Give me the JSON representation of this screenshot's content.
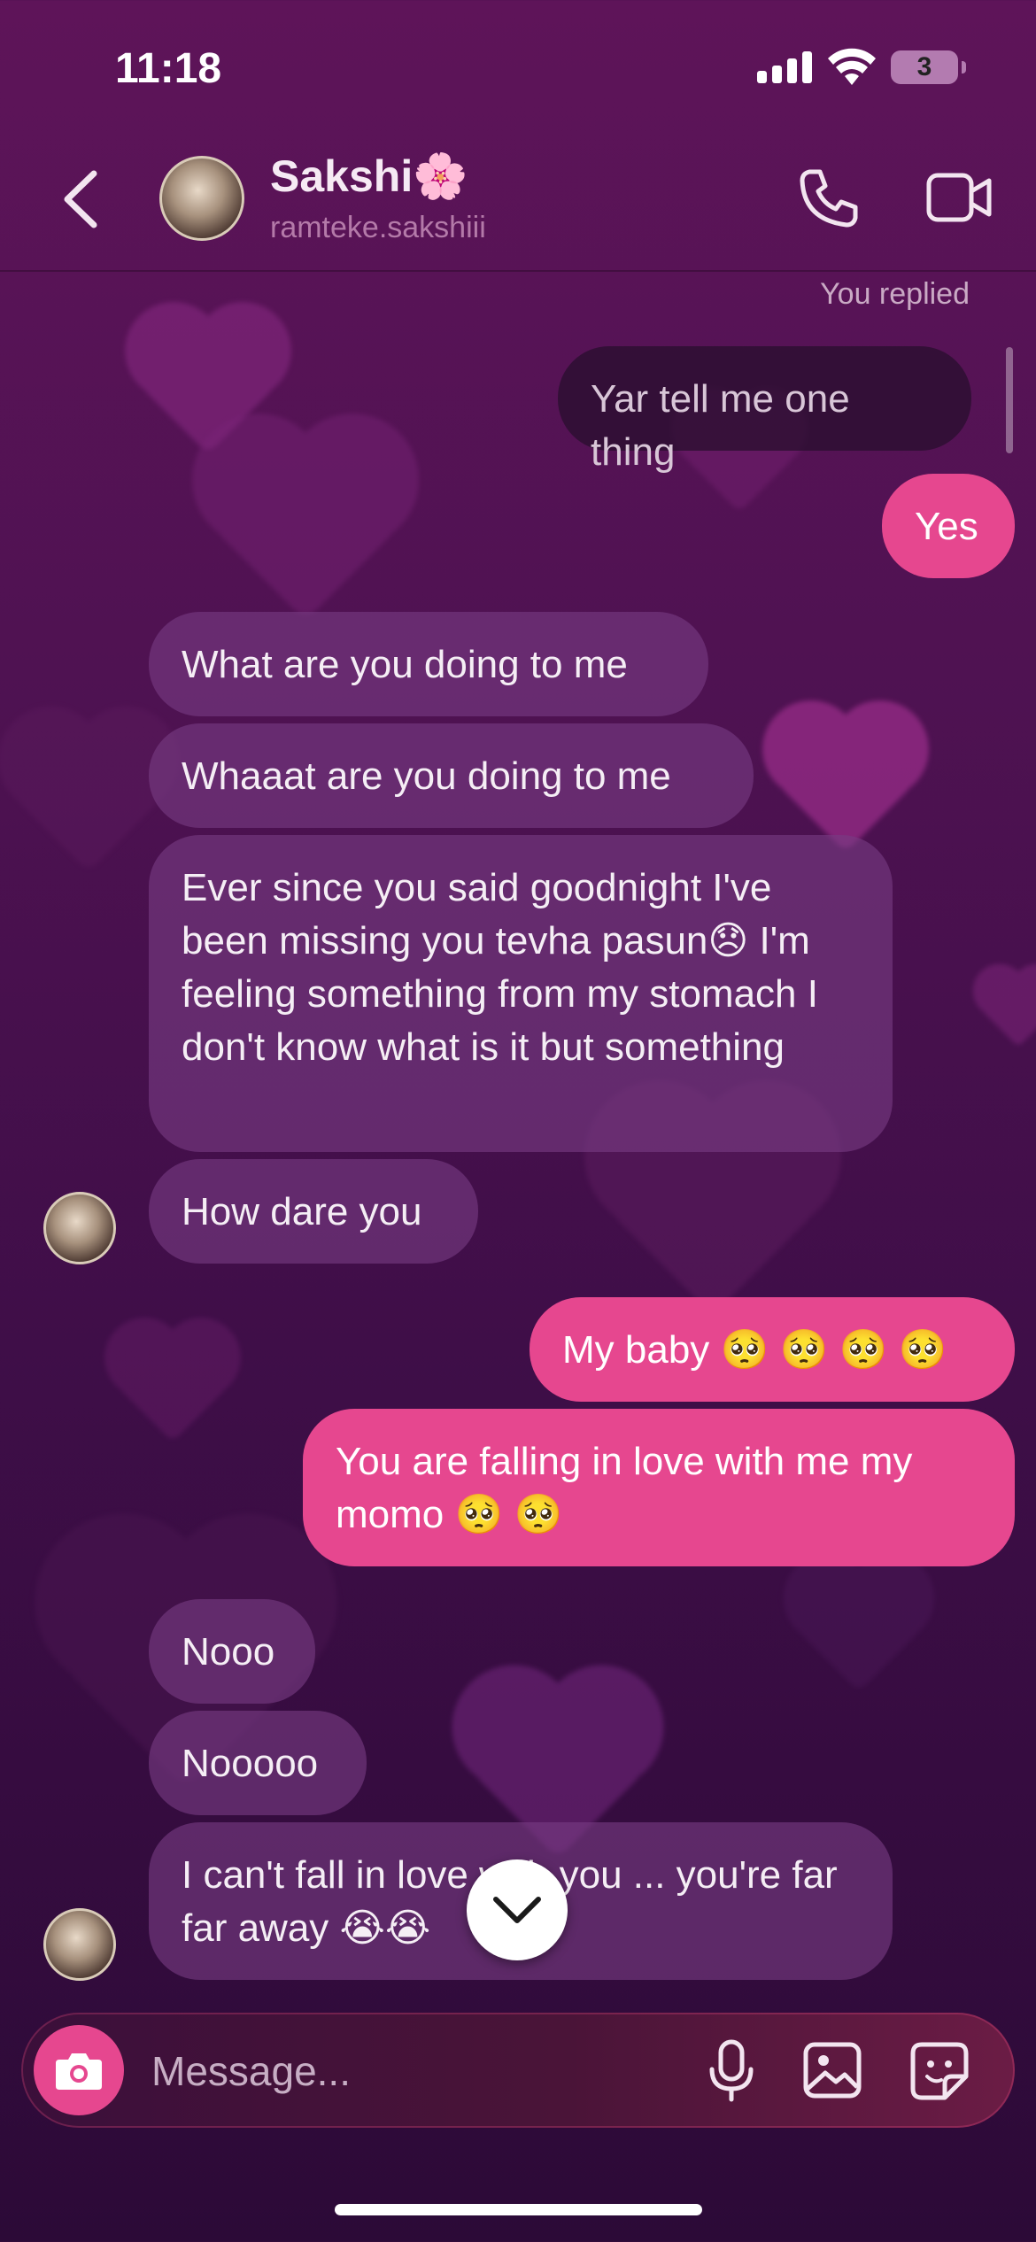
{
  "status_bar": {
    "time": "11:18",
    "battery": "3"
  },
  "header": {
    "name": "Sakshi🌸",
    "username": "ramteke.sakshiii"
  },
  "conversation": {
    "replied_label": "You replied",
    "messages": [
      {
        "from": "me",
        "style": "reply",
        "text": "Yar tell me one thing"
      },
      {
        "from": "me",
        "text": "Yes"
      },
      {
        "from": "them",
        "text": "What are you doing to me"
      },
      {
        "from": "them",
        "text": "Whaaat are you doing to me"
      },
      {
        "from": "them",
        "text": "Ever since you said goodnight I've been missing you tevha pasun😞 I'm feeling something from my stomach I don't know what is it but something"
      },
      {
        "from": "them",
        "text": "How dare you"
      },
      {
        "from": "me",
        "text": "My baby 🥺 🥺 🥺 🥺"
      },
      {
        "from": "me",
        "text": "You are falling in love with me my momo 🥺 🥺"
      },
      {
        "from": "them",
        "text": "Nooo"
      },
      {
        "from": "them",
        "text": "Nooooo"
      },
      {
        "from": "them",
        "text": "I can't fall in love with you ... you're far far away 😭😭"
      }
    ]
  },
  "composer": {
    "placeholder": "Message..."
  },
  "icons": [
    "back-chevron-icon",
    "phone-icon",
    "video-icon",
    "chevron-down-icon",
    "camera-icon",
    "microphone-icon",
    "gallery-icon",
    "sticker-icon"
  ],
  "colors": {
    "sent_bubble": "#e6478f",
    "received_bubble": "#6a3472",
    "background": "#4f1252"
  }
}
